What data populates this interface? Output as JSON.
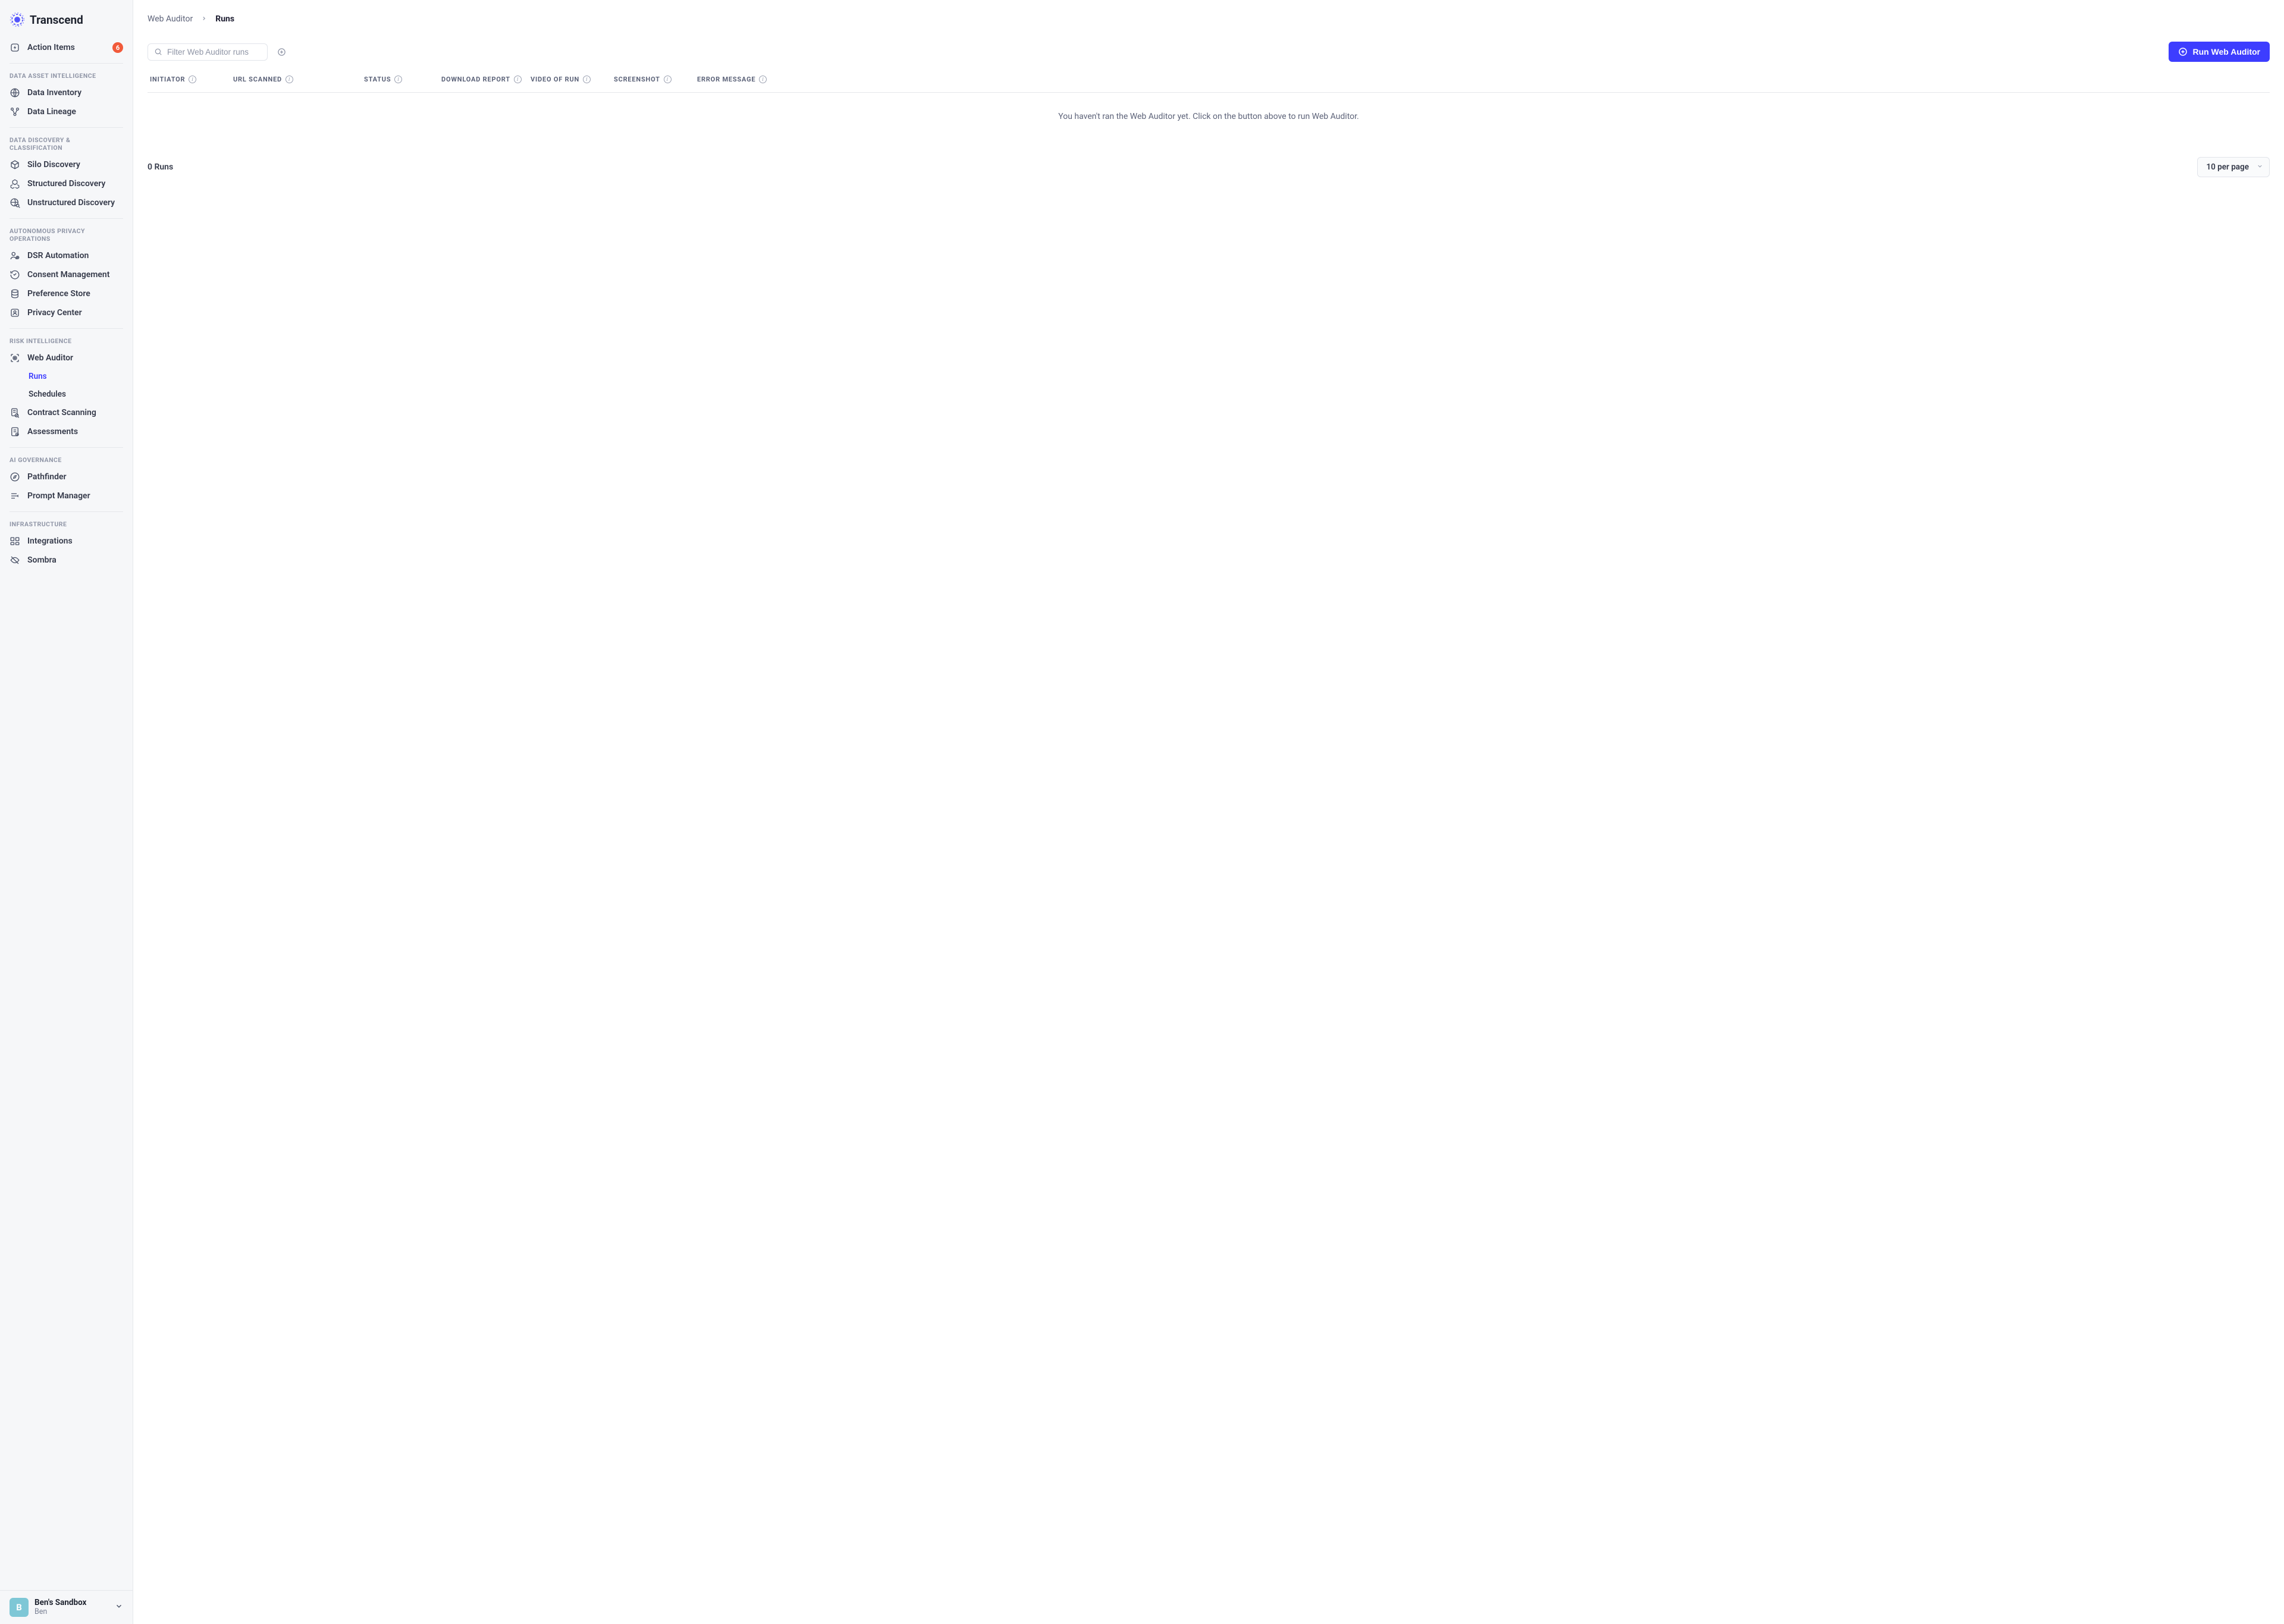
{
  "brand": "Transcend",
  "sidebar": {
    "action_items": {
      "label": "Action Items",
      "badge": "6"
    },
    "sections": [
      {
        "title": "Data Asset Intelligence",
        "items": [
          {
            "label": "Data Inventory",
            "icon": "globe"
          },
          {
            "label": "Data Lineage",
            "icon": "lineage"
          }
        ]
      },
      {
        "title": "Data Discovery & Classification",
        "items": [
          {
            "label": "Silo Discovery",
            "icon": "cube"
          },
          {
            "label": "Structured Discovery",
            "icon": "cubes"
          },
          {
            "label": "Unstructured Discovery",
            "icon": "globe-search"
          }
        ]
      },
      {
        "title": "Autonomous Privacy Operations",
        "items": [
          {
            "label": "DSR Automation",
            "icon": "dsr"
          },
          {
            "label": "Consent Management",
            "icon": "consent"
          },
          {
            "label": "Preference Store",
            "icon": "store"
          },
          {
            "label": "Privacy Center",
            "icon": "privacy"
          }
        ]
      },
      {
        "title": "Risk Intelligence",
        "items": [
          {
            "label": "Web Auditor",
            "icon": "scan",
            "children": [
              {
                "label": "Runs",
                "active": true
              },
              {
                "label": "Schedules"
              }
            ]
          },
          {
            "label": "Contract Scanning",
            "icon": "contract"
          },
          {
            "label": "Assessments",
            "icon": "assess"
          }
        ]
      },
      {
        "title": "AI Governance",
        "items": [
          {
            "label": "Pathfinder",
            "icon": "compass"
          },
          {
            "label": "Prompt Manager",
            "icon": "prompt"
          }
        ]
      },
      {
        "title": "Infrastructure",
        "items": [
          {
            "label": "Integrations",
            "icon": "integrations"
          },
          {
            "label": "Sombra",
            "icon": "sombra"
          }
        ]
      }
    ]
  },
  "user": {
    "initial": "B",
    "workspace": "Ben's Sandbox",
    "name": "Ben"
  },
  "breadcrumb": {
    "parent": "Web Auditor",
    "current": "Runs"
  },
  "filter_placeholder": "Filter Web Auditor runs",
  "run_button": "Run Web Auditor",
  "columns": [
    "Initiator",
    "URL Scanned",
    "Status",
    "Download Report",
    "Video of Run",
    "Screenshot",
    "Error Message"
  ],
  "empty_message": "You haven't ran the Web Auditor yet. Click on the button above to run Web Auditor.",
  "count_label": "0 Runs",
  "page_size": "10 per page"
}
